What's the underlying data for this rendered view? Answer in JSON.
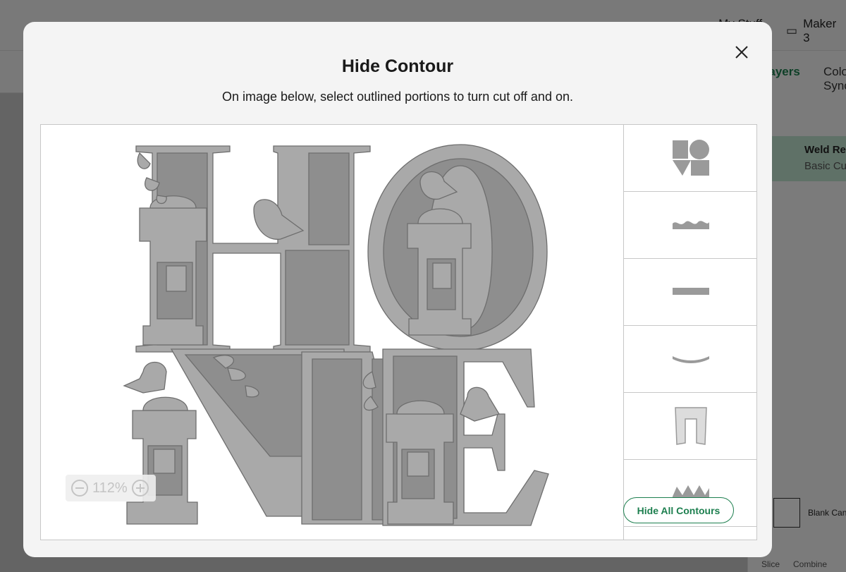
{
  "background": {
    "topbar": {
      "my_stuff": "My Stuff",
      "machine": "Maker 3"
    },
    "panel_tabs": {
      "layers": "Layers",
      "color": "Color Sync"
    },
    "layer": {
      "name": "Weld Result",
      "type": "Basic Cut"
    },
    "blank_canvas": "Blank Canvas",
    "bottom_tools": {
      "slice": "Slice",
      "combine": "Combine"
    }
  },
  "modal": {
    "title": "Hide Contour",
    "subtitle": "On image below, select outlined portions to turn cut off and on.",
    "close_icon": "close-icon",
    "zoom": {
      "value": "112%",
      "minus_icon": "zoom-out-icon",
      "plus_icon": "zoom-in-icon"
    },
    "hide_all_label": "Hide All Contours",
    "thumbnails": [
      "home-design-thumb",
      "wave-band-thumb",
      "bar-thumb",
      "curve-thumb",
      "door-frame-thumb",
      "crown-thumb"
    ]
  },
  "colors": {
    "accent": "#1d7f4f",
    "layer_highlight": "#bfe2cf",
    "shape_fill": "#8f8f8f",
    "shape_light": "#a8a8a8"
  }
}
